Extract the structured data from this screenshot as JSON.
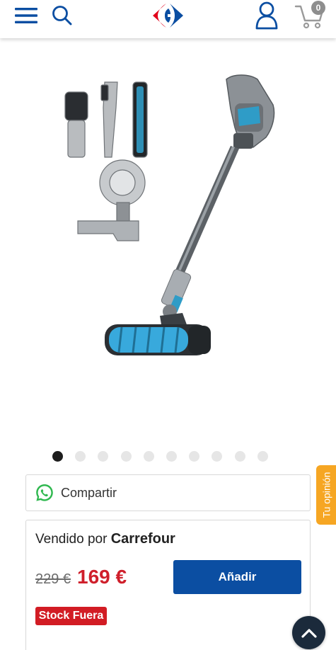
{
  "header": {
    "menu_icon": "hamburger-menu-icon",
    "search_icon": "search-icon",
    "logo": "carrefour-logo",
    "account_icon": "user-icon",
    "cart_icon": "cart-icon",
    "cart_count": "0",
    "brand_colors": {
      "blue": "#0b4ea2",
      "red": "#e2001a"
    }
  },
  "product": {
    "image": "cordless-stick-vacuum-with-accessories",
    "carousel": {
      "total": 10,
      "active_index": 0
    }
  },
  "share": {
    "icon": "whatsapp-icon",
    "label": "Compartir"
  },
  "side_tab": {
    "label": "Tu opinión",
    "color": "#f6a623"
  },
  "offer": {
    "seller_prefix": "Vendido por",
    "seller_name": "Carrefour",
    "old_price": "229 €",
    "price": "169 €",
    "add_button": "Añadir",
    "stock_badge": "Stock Fuera",
    "price_color": "#cf1f2b",
    "button_color": "#0b4ea2"
  },
  "scroll_top_icon": "chevron-up-icon"
}
